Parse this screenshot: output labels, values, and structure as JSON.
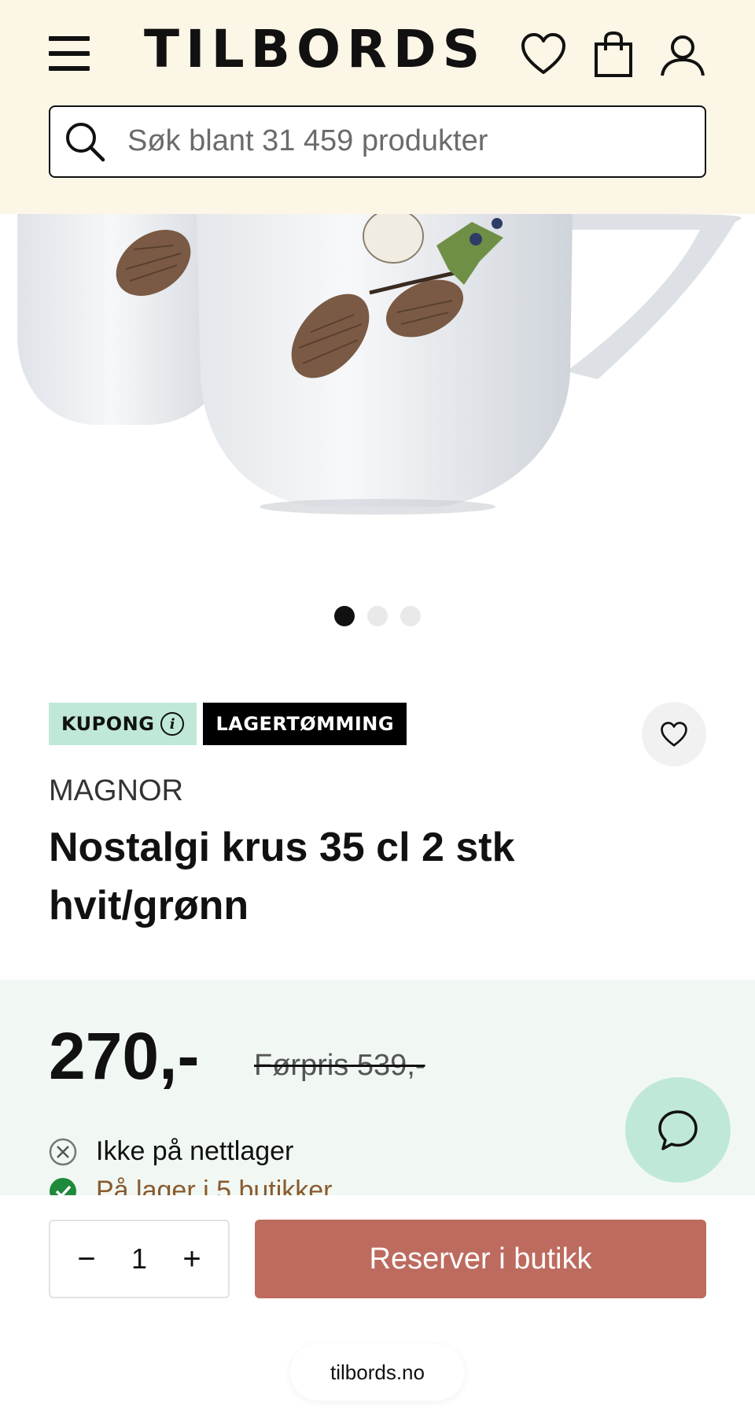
{
  "header": {
    "logo": "TILBORDS",
    "search_placeholder": "Søk blant 31 459 produkter",
    "icons": [
      "menu-icon",
      "heart-icon",
      "bag-icon",
      "user-icon",
      "search-icon"
    ]
  },
  "carousel": {
    "slides": 3,
    "active_index": 0
  },
  "badges": {
    "kupong": "KUPONG",
    "lager": "LAGERTØMMING"
  },
  "product": {
    "brand": "MAGNOR",
    "title": "Nostalgi krus 35 cl 2 stk hvit/grønn"
  },
  "pricing": {
    "price": "270,-",
    "old_price": "Førpris 539,-"
  },
  "stock": {
    "online": "Ikke på nettlager",
    "stores": "På lager i 5 butikker"
  },
  "cart": {
    "quantity": "1",
    "minus": "−",
    "plus": "+",
    "reserve_label": "Reserver i butikk"
  },
  "browser": {
    "url": "tilbords.no"
  },
  "colors": {
    "header_bg": "#fbf6e5",
    "mint": "#bfe9d6",
    "price_band_bg": "#f1f8f3",
    "reserve_button": "#bd6b5f",
    "stock_ok": "#1f8a3a"
  }
}
